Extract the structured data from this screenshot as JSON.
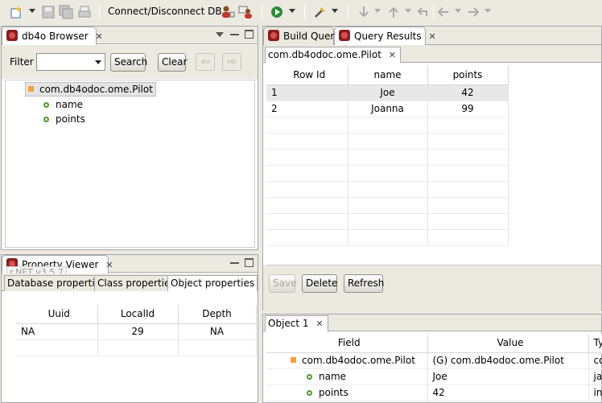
{
  "toolbar": {
    "connect_label": "Connect/Disconnect DB",
    "icons": [
      "new-wizard-icon",
      "save-icon",
      "save-all-icon",
      "print-icon",
      "user-login-icon",
      "user-switch-icon",
      "run-icon",
      "tool-icon",
      "nav-down-icon",
      "nav-up-icon",
      "back-icon",
      "prev-icon",
      "next-icon"
    ]
  },
  "browser": {
    "title": "db4o Browser",
    "filter_label": "Filter",
    "filter_value": "",
    "search_label": "Search",
    "clear_label": "Clear",
    "prev_arrow": "⇦",
    "next_arrow": "⇨",
    "tree": {
      "class_name": "com.db4odoc.ome.Pilot",
      "fields": [
        "name",
        "points"
      ]
    }
  },
  "property_viewer": {
    "title": "Property Viewer",
    "ghost_text": "r.NET v3.5.7",
    "tabs": [
      "Database properties",
      "Class properties",
      "Object properties"
    ],
    "active_tab": "Object properties",
    "columns": [
      "Uuid",
      "LocalId",
      "Depth"
    ],
    "rows": [
      [
        "NA",
        "29",
        "NA"
      ]
    ]
  },
  "editor": {
    "tabs": [
      "Build Query",
      "Query Results"
    ],
    "active_tab": "Query Results",
    "results_tab": "com.db4odoc.ome.Pilot",
    "columns": [
      "Row Id",
      "name",
      "points"
    ],
    "rows": [
      {
        "id": "1",
        "name": "Joe",
        "points": "42"
      },
      {
        "id": "2",
        "name": "Joanna",
        "points": "99"
      }
    ],
    "save_label": "Save",
    "delete_label": "Delete",
    "refresh_label": "Refresh"
  },
  "object_panel": {
    "tab": "Object 1",
    "columns": [
      "Field",
      "Value",
      "Ty"
    ],
    "rows": [
      {
        "field": "com.db4odoc.ome.Pilot",
        "value": "(G) com.db4odoc.ome.Pilot",
        "type": "co"
      },
      {
        "field": "name",
        "value": "Joe",
        "type": "jav"
      },
      {
        "field": "points",
        "value": "42",
        "type": "in"
      }
    ]
  }
}
